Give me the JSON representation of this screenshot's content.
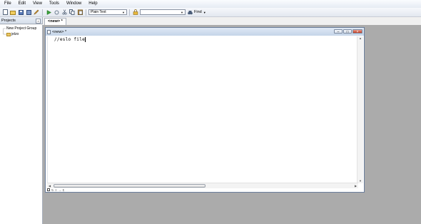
{
  "menubar": {
    "items": [
      "File",
      "Edit",
      "View",
      "Tools",
      "Window",
      "Help"
    ]
  },
  "toolbar": {
    "syntax_combo": "Plain Text",
    "search_combo": "",
    "find_label": "Find"
  },
  "panel": {
    "title": "Projects",
    "tree": {
      "group": "New Project Group",
      "project": "jelzo"
    }
  },
  "tabs": {
    "active": "<new> *"
  },
  "document": {
    "title": "<new> *",
    "content": "//eslo file"
  },
  "colors": {
    "workspace": "#ababab",
    "title_gradient_top": "#dfe9f5",
    "close_button": "#c43c22"
  }
}
